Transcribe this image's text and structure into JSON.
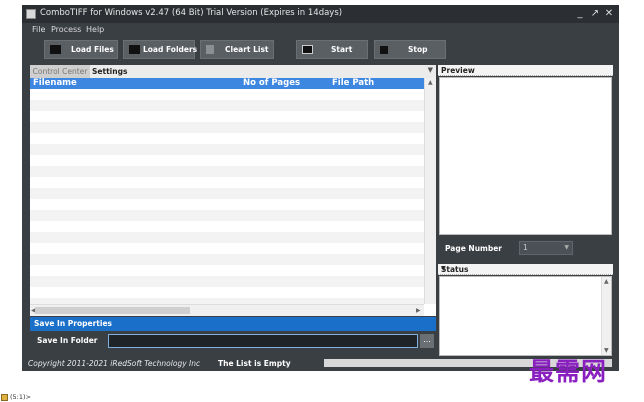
{
  "window": {
    "title": "ComboTIFF for Windows v2.47 (64 Bit)  Trial Version (Expires in 14days)",
    "controls": {
      "minimize": "_",
      "maximize": "↗",
      "close": "✕"
    }
  },
  "menu": [
    "File",
    "Process",
    "Help"
  ],
  "toolbar": [
    {
      "label": "Load Files",
      "icon": "folder-icon"
    },
    {
      "label": "Load Folders",
      "icon": "folders-icon"
    },
    {
      "label": "Cleart List",
      "icon": "document-icon"
    },
    {
      "label": "Start",
      "icon": "play-icon"
    },
    {
      "label": "Stop",
      "icon": "stop-icon"
    }
  ],
  "tabs": {
    "control_center": "Control Center",
    "settings": "Settings"
  },
  "file_list": {
    "columns": [
      "Filename",
      "No of Pages",
      "File Path"
    ],
    "rows": []
  },
  "save": {
    "header": "Save In Properties",
    "folder_label": "Save In Folder",
    "folder_value": "",
    "browse_label": "..."
  },
  "preview": {
    "header": "Preview",
    "page_number_label": "Page Number",
    "page_number_value": "1"
  },
  "status_panel": {
    "header": "Status"
  },
  "statusbar": {
    "copyright": "Copyright 2011-2021 iRedSoft Technology Inc",
    "message": "The List is Empty"
  },
  "watermark": "最需网",
  "taskbar_fragment": "(5:1)>",
  "colors": {
    "grid_header": "#3d87e0",
    "save_header": "#1a6fc8",
    "window_bg": "#3a3f44",
    "watermark": "#8a1fc0"
  }
}
